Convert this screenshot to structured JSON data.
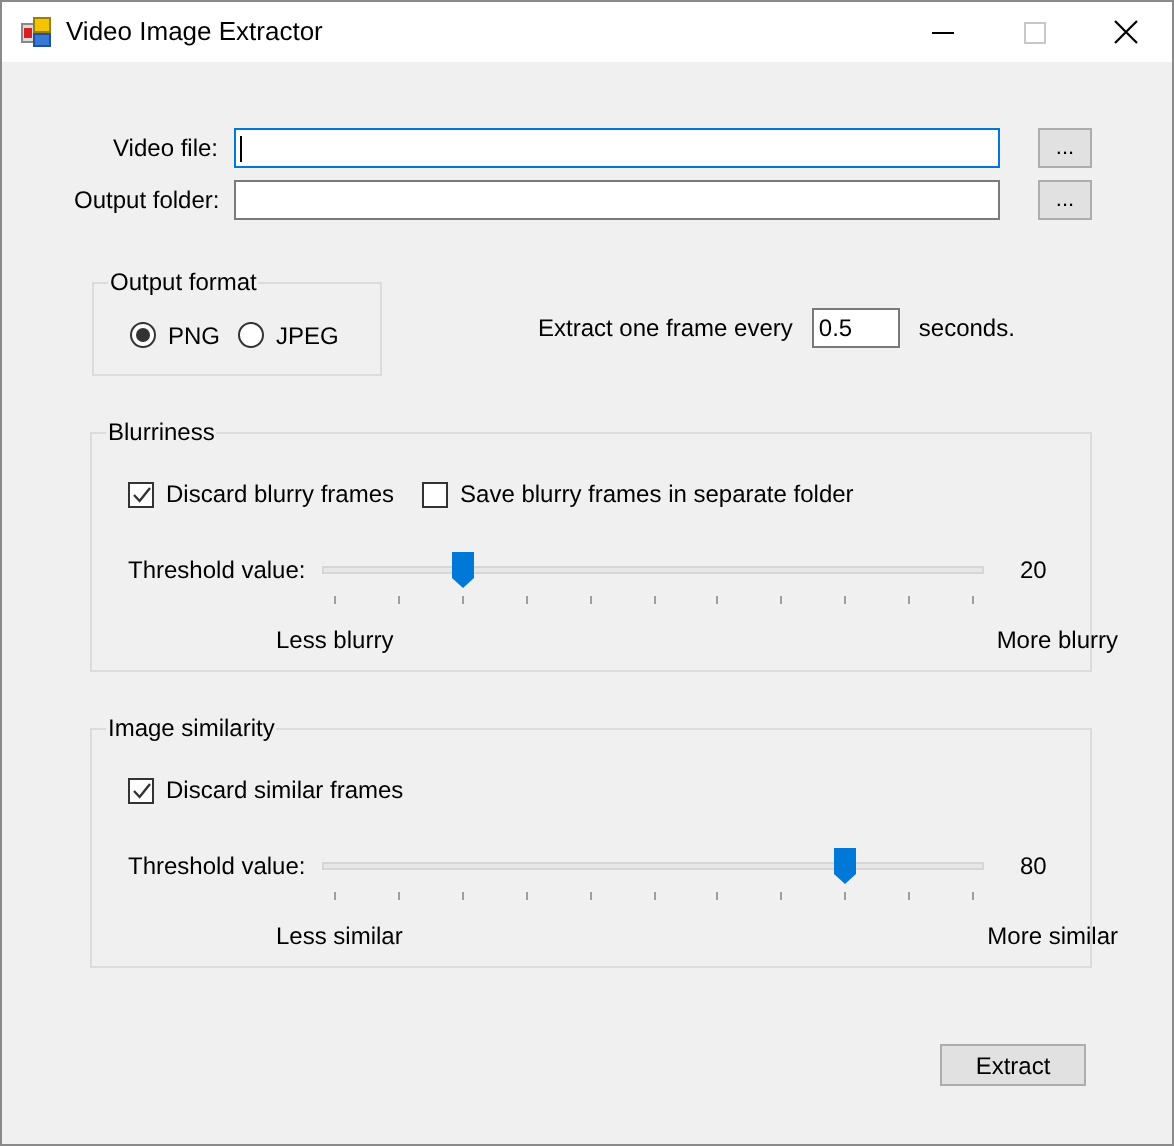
{
  "window": {
    "title": "Video Image Extractor"
  },
  "fields": [
    {
      "label": "Video file:",
      "focused": true,
      "browse": "..."
    },
    {
      "label": "Output folder:",
      "focused": false,
      "browse": "..."
    }
  ],
  "output_format": {
    "title": "Output format",
    "options": [
      {
        "label": "PNG",
        "selected": true
      },
      {
        "label": "JPEG",
        "selected": false
      }
    ]
  },
  "interval": {
    "label": "Extract one frame every",
    "value": "0.5",
    "unit": "seconds."
  },
  "groups": [
    {
      "title": "Blurriness",
      "checkboxes": [
        {
          "label": "Discard blurry frames",
          "checked": true
        },
        {
          "label": "Save blurry frames in separate folder",
          "checked": false
        }
      ],
      "slider": {
        "label": "Threshold value:",
        "level": 0.2,
        "reading": "20",
        "min_label": "Less blurry",
        "max_label": "More blurry"
      }
    },
    {
      "title": "Image similarity",
      "checkboxes": [
        {
          "label": "Discard similar frames",
          "checked": true
        }
      ],
      "slider": {
        "label": "Threshold value:",
        "level": 0.8,
        "reading": "80",
        "min_label": "Less similar",
        "max_label": "More similar"
      }
    }
  ],
  "extract_button": "Extract"
}
